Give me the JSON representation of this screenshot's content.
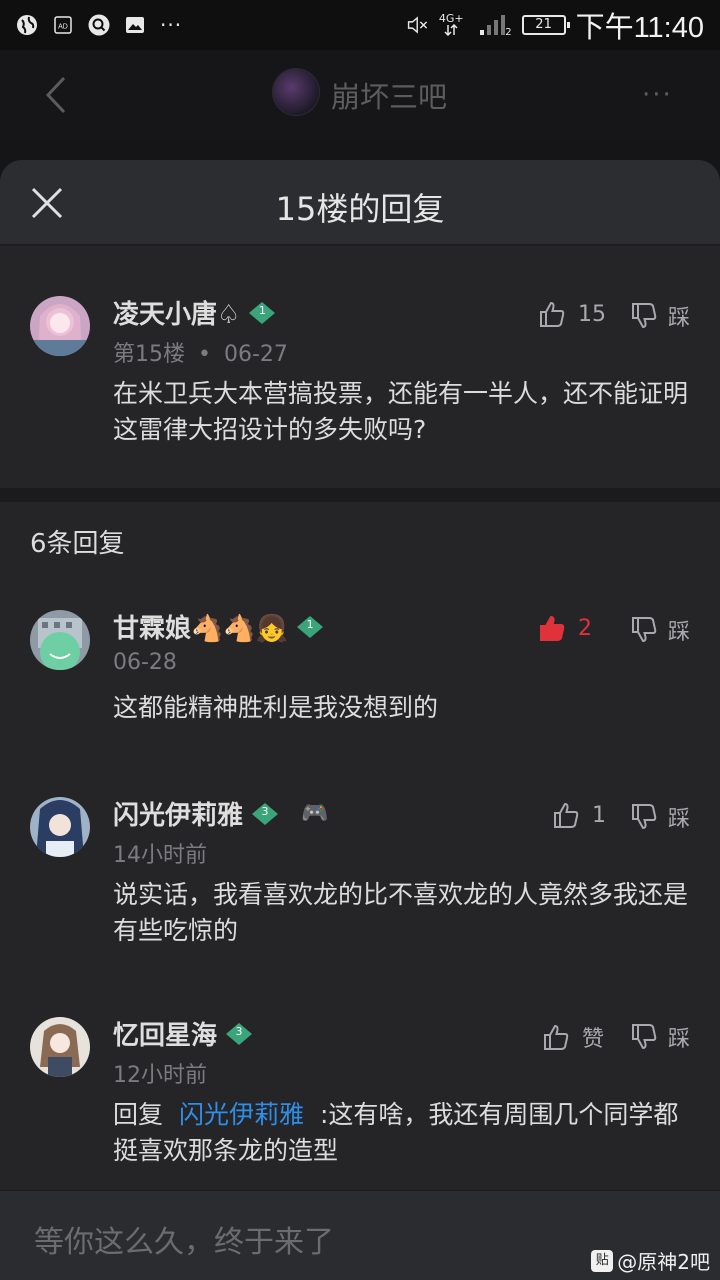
{
  "status_bar": {
    "time": "下午11:40",
    "network": "4G+",
    "sim_slot": "2",
    "battery": "21",
    "icons": [
      "globe-icon",
      "ad-icon",
      "search-icon",
      "image-icon"
    ],
    "overflow": "···"
  },
  "nav": {
    "forum_name": "崩坏三吧",
    "more_label": "···"
  },
  "sheet": {
    "title": "15楼的回复"
  },
  "floor_post": {
    "author": "凌天小唐♤",
    "level": "1",
    "floor": "第15楼",
    "dot": "•",
    "date": "06-27",
    "likes": "15",
    "dislike_label": "踩",
    "content": "在米卫兵大本营搞投票，还能有一半人，还不能证明这雷律大招设计的多失败吗?"
  },
  "reply_count_label": "6条回复",
  "replies": [
    {
      "author": "甘霖娘🐴🐴👧",
      "level": "1",
      "time": "06-28",
      "likes": "2",
      "liked": true,
      "dislike_label": "踩",
      "content": "这都能精神胜利是我没想到的"
    },
    {
      "author": "闪光伊莉雅",
      "level": "3",
      "badge": "🎮",
      "time": "14小时前",
      "likes": "1",
      "liked": false,
      "dislike_label": "踩",
      "content": "说实话，我看喜欢龙的比不喜欢龙的人竟然多我还是有些吃惊的"
    },
    {
      "author": "忆回星海",
      "level": "3",
      "time": "12小时前",
      "likes": "赞",
      "liked": false,
      "dislike_label": "踩",
      "reply_prefix": "回复",
      "mention": "闪光伊莉雅",
      "content": ":这有啥，我还有周围几个同学都挺喜欢那条龙的造型"
    }
  ],
  "input": {
    "placeholder": "等你这么久，终于来了"
  },
  "watermark": {
    "logo": "贴",
    "text": "@原神2吧"
  },
  "colors": {
    "background": "#151517",
    "sheet": "#252528",
    "accent_like": "#e0323b",
    "mention": "#2f8ee8",
    "level_badge": "#3aa57a"
  }
}
